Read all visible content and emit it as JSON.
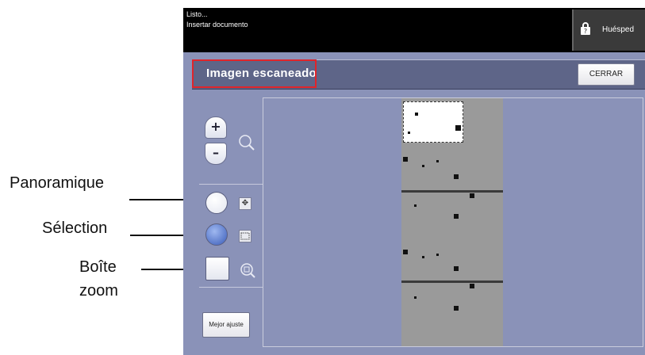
{
  "status": {
    "line1": "Listo...",
    "line2": "Insertar documento"
  },
  "user": {
    "label": "Huésped",
    "icon": "guest-lock-icon"
  },
  "header": {
    "title": "Imagen escaneado",
    "close_label": "CERRAR",
    "highlight_color": "#e0242a"
  },
  "tools": {
    "zoom_in_label": "+",
    "zoom_out_label": "–",
    "fit_label": "Mejor ajuste",
    "pan_icon": "move-icon",
    "select_icon": "marquee-icon",
    "zoom_box_icon": "zoom-box-icon"
  },
  "callouts": {
    "pan": "Panoramique",
    "selection": "Sélection",
    "zoom_box_line1": "Boîte",
    "zoom_box_line2": "zoom"
  },
  "colors": {
    "screen_bg": "#8a92b8",
    "status_bg": "#000000",
    "selected_radio": "#3a5cb8"
  }
}
